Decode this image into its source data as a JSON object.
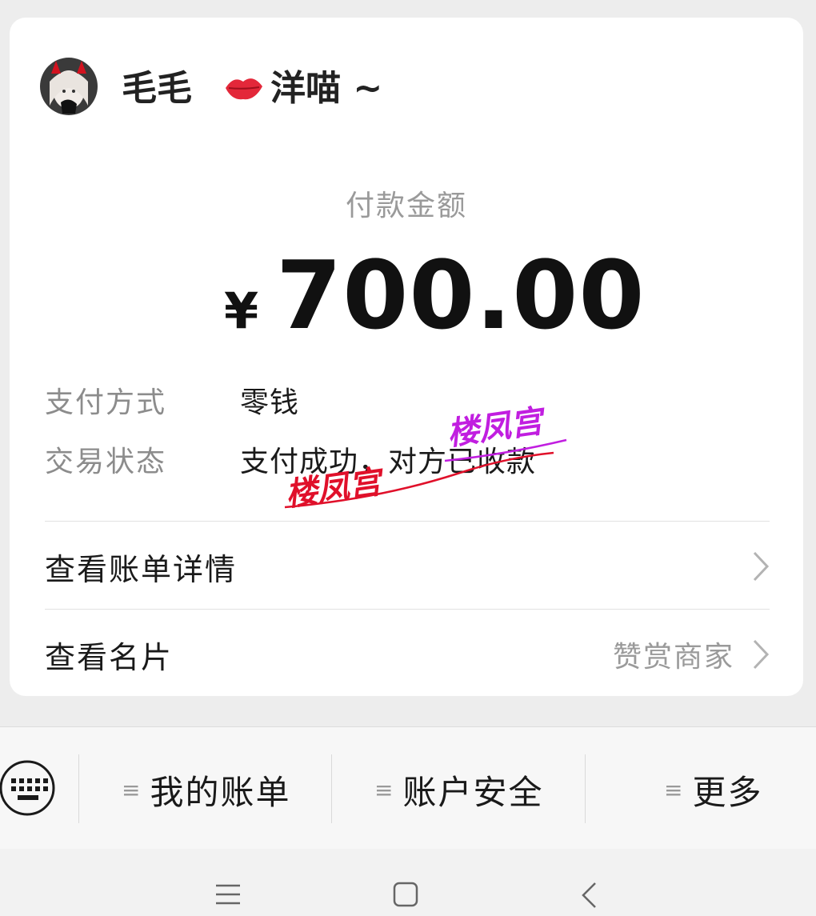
{
  "payee": {
    "name": "毛毛",
    "nickname": "洋喵 ~"
  },
  "payment": {
    "amount_label": "付款金额",
    "currency_symbol": "¥",
    "amount": "700.00"
  },
  "details": [
    {
      "label": "支付方式",
      "value": "零钱"
    },
    {
      "label": "交易状态",
      "value": "支付成功，对方已收款"
    }
  ],
  "links": {
    "bill_details": "查看账单详情",
    "view_card": "查看名片",
    "view_card_sub": "赞赏商家"
  },
  "watermark": {
    "text_1": "楼凤宫",
    "text_2": "楼凤宫",
    "color_1": "#e0102a",
    "color_2": "#c11ee0"
  },
  "bottom_menu": {
    "items": [
      {
        "label": "我的账单"
      },
      {
        "label": "账户安全"
      },
      {
        "label": "更多"
      }
    ]
  },
  "icons": {
    "keyboard": "keyboard-icon",
    "menu": "menu-lines-icon",
    "chevron": "chevron-right-icon",
    "nav_recent": "recent-apps-icon",
    "nav_home": "home-icon",
    "nav_back": "back-icon"
  }
}
